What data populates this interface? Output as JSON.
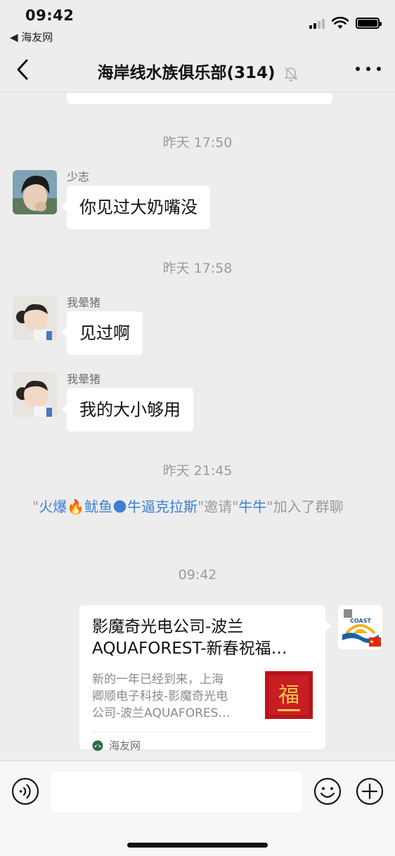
{
  "status_bar": {
    "time": "09:42",
    "back_app": "◀ 海友网"
  },
  "nav": {
    "title": "海岸线水族俱乐部(314)",
    "mute_icon": "bell-off-icon",
    "more_icon": "more-icon"
  },
  "messages": [
    {
      "timestamp": "昨天 17:50",
      "sender": "少志",
      "text": "你见过大奶嘴没"
    },
    {
      "timestamp": "昨天 17:58",
      "sender": "我晕猪",
      "text": "见过啊"
    },
    {
      "sender": "我晕猪",
      "text": "我的大小够用"
    }
  ],
  "system": {
    "timestamp": "昨天 21:45",
    "q1": "\"",
    "inviter": "火爆🔥鱿鱼🌑牛逼克拉斯",
    "q2": "\"邀请\"",
    "invitee": "牛牛",
    "tail": "\"加入了群聊"
  },
  "link_card": {
    "timestamp": "09:42",
    "title_line1": "影魔奇光电公司-波兰",
    "title_line2": "AQUAFOREST-新春祝福…",
    "desc_line1": "新的一年已经到来，上海",
    "desc_line2": "卿顺电子科技-影魔奇光电",
    "desc_line3": "公司-波兰AQUAFORES…",
    "thumb_char": "福",
    "source": "海友网"
  },
  "input_bar": {
    "placeholder": "",
    "voice_icon": "voice-icon",
    "emoji_icon": "emoji-icon",
    "plus_icon": "plus-icon"
  },
  "colors": {
    "background": "#ededed",
    "bubble": "#ffffff",
    "link": "#3b7fd4",
    "muted_text": "#9b9b9b"
  }
}
